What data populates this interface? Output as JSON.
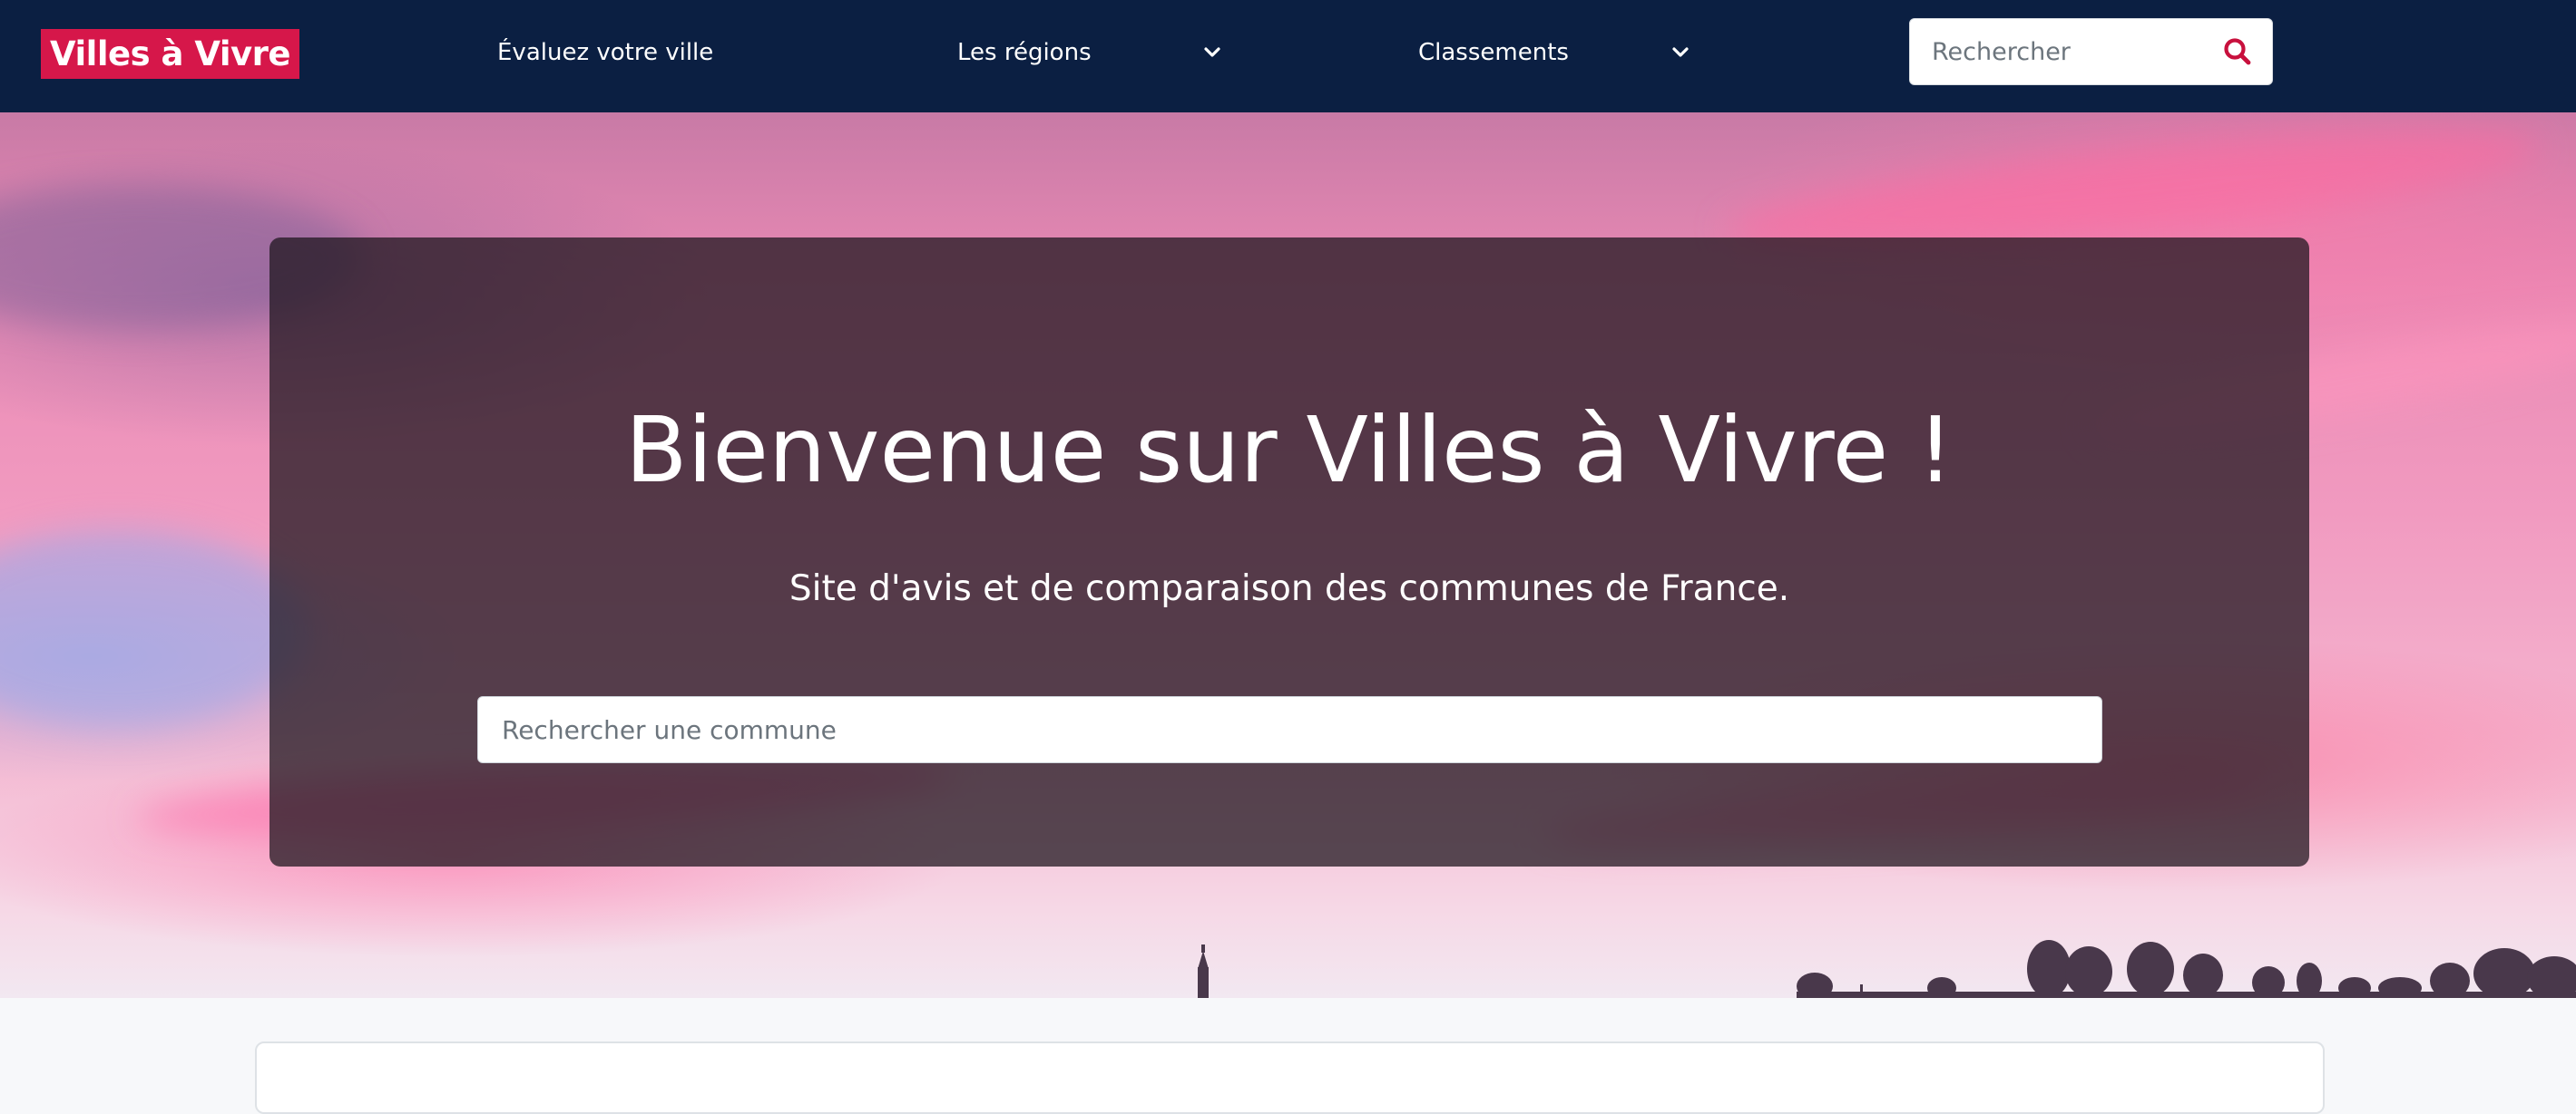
{
  "header": {
    "logo_text": "Villes à Vivre",
    "nav": {
      "evaluez": "Évaluez votre ville",
      "regions": "Les régions",
      "classements": "Classements"
    },
    "search_placeholder": "Rechercher"
  },
  "hero": {
    "title": "Bienvenue sur Villes à Vivre !",
    "subtitle": "Site d'avis et de comparaison des communes de France.",
    "search_placeholder": "Rechercher une commune"
  },
  "colors": {
    "navbar": "#0b1f42",
    "brand": "#d6174a",
    "search_icon": "#c8103d"
  },
  "icons": {
    "regions_dropdown": "chevron-down-icon",
    "classements_dropdown": "chevron-down-icon",
    "search": "search-icon"
  }
}
